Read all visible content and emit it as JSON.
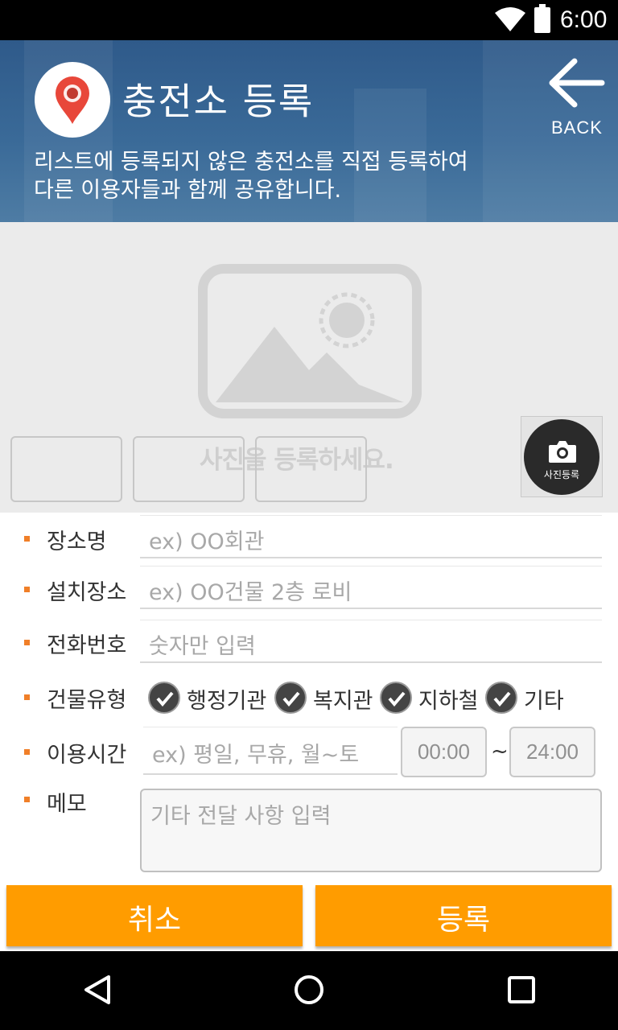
{
  "status_bar": {
    "time": "6:00"
  },
  "header": {
    "title": "충전소 등록",
    "subtitle_line1": "리스트에 등록되지 않은 충전소를 직접 등록하여",
    "subtitle_line2": "다른 이용자들과 함께 공유합니다.",
    "back_label": "BACK"
  },
  "photo": {
    "hint": "사진을 등록하세요.",
    "camera_label": "사진등록"
  },
  "form": {
    "place_name": {
      "label": "장소명",
      "placeholder": "ex) OO회관"
    },
    "install_location": {
      "label": "설치장소",
      "placeholder": "ex) OO건물 2층 로비"
    },
    "phone": {
      "label": "전화번호",
      "placeholder": "숫자만 입력"
    },
    "building_type": {
      "label": "건물유형",
      "options": [
        "행정기관",
        "복지관",
        "지하철",
        "기타"
      ]
    },
    "usage_time": {
      "label": "이용시간",
      "placeholder": "ex) 평일, 무휴, 월~토",
      "start": "00:00",
      "separator": "~",
      "end": "24:00"
    },
    "memo": {
      "label": "메모",
      "placeholder": "기타 전달 사항 입력"
    }
  },
  "buttons": {
    "cancel": "취소",
    "submit": "등록"
  },
  "colors": {
    "accent": "#ff9c00",
    "bullet": "#f07f28",
    "header": "#3a6a98",
    "pin": "#e8473a"
  }
}
